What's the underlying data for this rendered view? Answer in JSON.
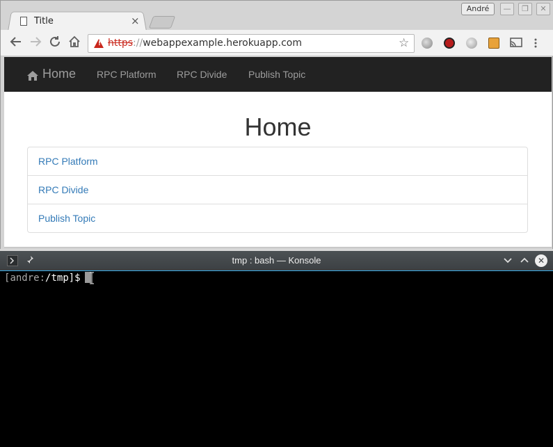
{
  "browser": {
    "tab": {
      "title": "Title",
      "close_glyph": "×"
    },
    "user_badge": "André",
    "window_controls": {
      "minimize": "—",
      "restore": "❐",
      "close": "✕"
    },
    "url": {
      "scheme": "https",
      "separator": "://",
      "host": "webappexample.herokuapp.com"
    },
    "nav_icons": [
      "back-arrow-icon",
      "forward-arrow-icon",
      "reload-icon",
      "home-icon"
    ],
    "extension_icons": [
      "globe-icon",
      "blocker-icon",
      "globe-gray-icon",
      "extension-icon",
      "cast-icon",
      "menu-dots-icon"
    ]
  },
  "page": {
    "navbar": {
      "brand": "Home",
      "links": [
        "RPC Platform",
        "RPC Divide",
        "Publish Topic"
      ]
    },
    "heading": "Home",
    "list": [
      "RPC Platform",
      "RPC Divide",
      "Publish Topic"
    ]
  },
  "konsole": {
    "title": "tmp : bash — Konsole",
    "prompt": {
      "open": "[",
      "user": "andre",
      "sep": ":",
      "path": "/tmp",
      "close": "]$"
    }
  },
  "colors": {
    "navbar_bg": "#222222",
    "link": "#337ab7",
    "warning_red": "#c9271c",
    "konsole_accent": "#3daee9"
  }
}
